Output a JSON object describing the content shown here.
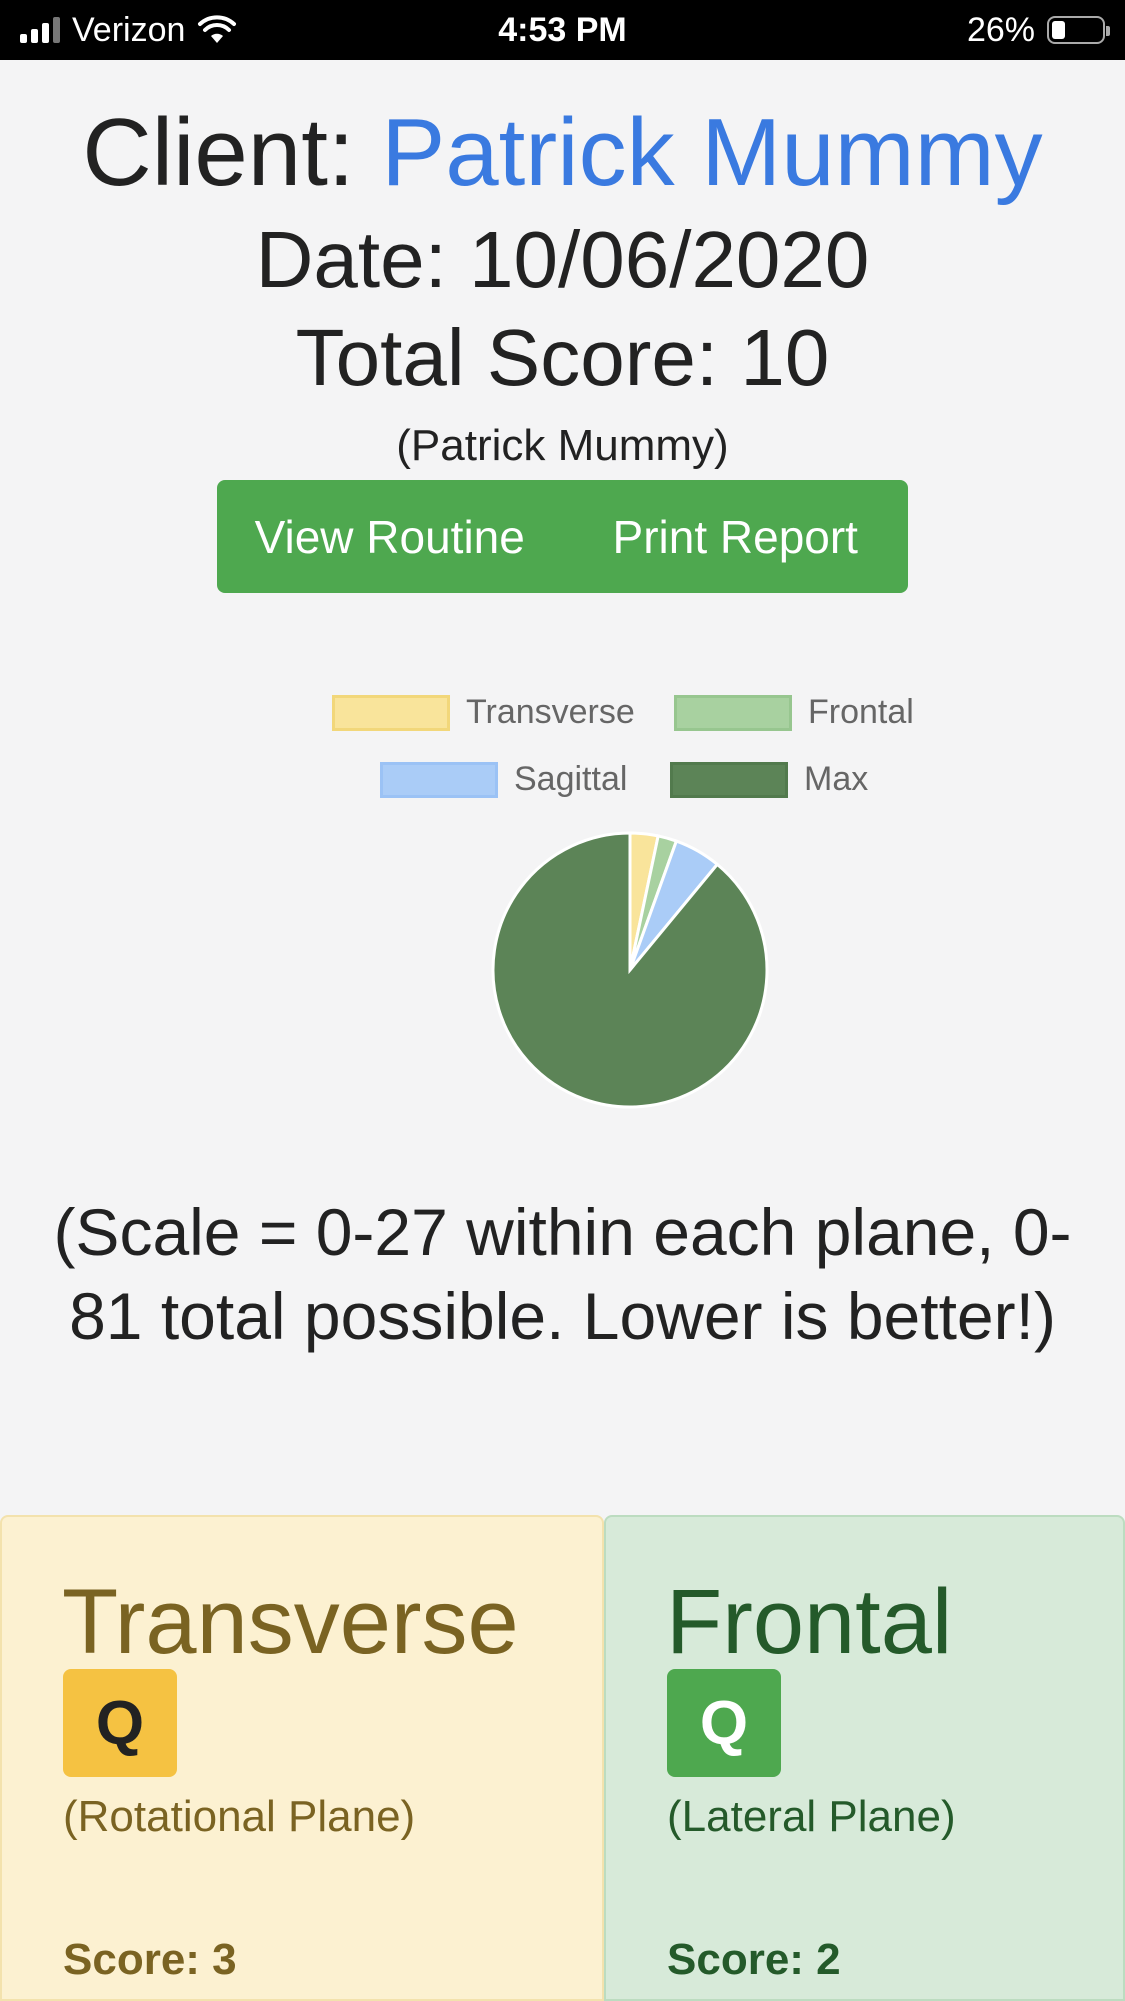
{
  "status_bar": {
    "carrier": "Verizon",
    "time": "4:53 PM",
    "battery": "26%"
  },
  "header": {
    "client_label": "Client: ",
    "client_name": "Patrick Mummy",
    "date": "Date: 10/06/2020",
    "total_score": "Total Score: 10",
    "sub_name": "(Patrick Mummy)"
  },
  "actions": {
    "view_routine": "View Routine",
    "print_report": "Print Report"
  },
  "chart_data": {
    "type": "pie",
    "legend": [
      {
        "label": "Transverse",
        "color": "#f9e49b"
      },
      {
        "label": "Frontal",
        "color": "#a8d1a0"
      },
      {
        "label": "Sagittal",
        "color": "#aaccf7"
      },
      {
        "label": "Max",
        "color": "#5c8457"
      }
    ],
    "categories": [
      "Transverse",
      "Frontal",
      "Sagittal",
      "Max"
    ],
    "values": [
      3,
      2,
      5,
      81
    ],
    "legend_position": "top"
  },
  "scale_note": "(Scale = 0-27 within each plane, 0-81 total possible. Lower is better!)",
  "cards": [
    {
      "title": "Transverse",
      "badge": "Q",
      "plane": "(Rotational Plane)",
      "score": "Score: 3"
    },
    {
      "title": "Frontal",
      "badge": "Q",
      "plane": "(Lateral Plane)",
      "score": "Score: 2"
    }
  ]
}
